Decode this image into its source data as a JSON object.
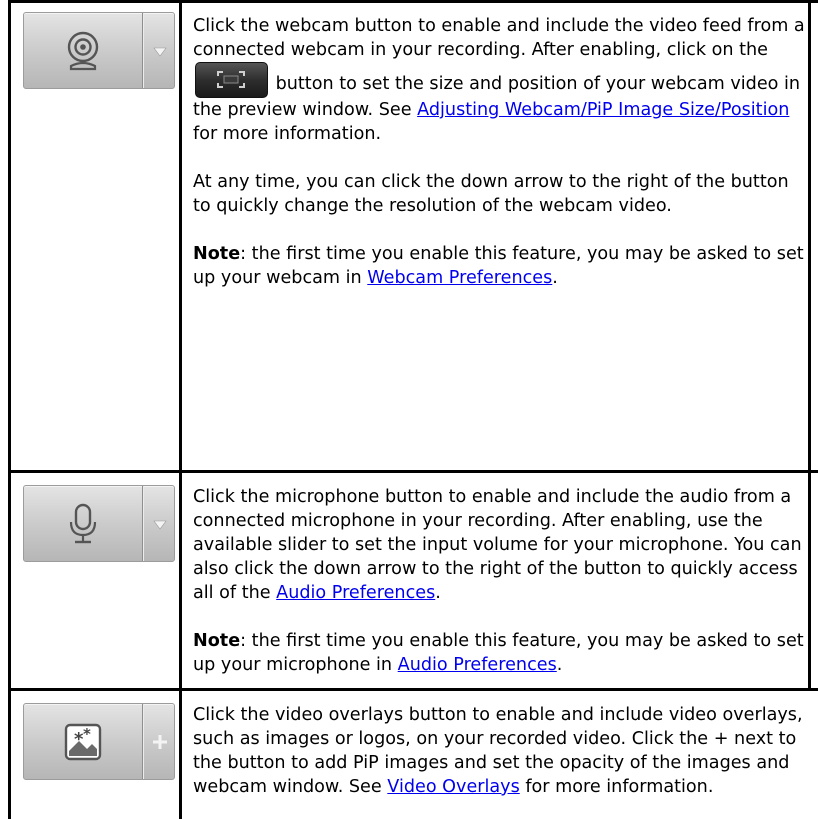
{
  "rows": [
    {
      "icon": "webcam-icon",
      "side_icon": "dropdown-arrow-icon",
      "p1_a": "Click the webcam button to enable and include the video feed from a connected webcam in your recording. After enabling, click on the",
      "p1_b": "button to set the size and position of your webcam video in the preview window. See",
      "p1_link": "Adjusting Webcam/PiP Image Size/Position",
      "p1_c": "for more information.",
      "p2": "At any time, you can click the down arrow to the right of the button to quickly change the resolution of the webcam video.",
      "note_label": "Note",
      "note_text": ": the first time you enable this feature, you may be asked to set up your webcam in",
      "note_link": "Webcam Preferences",
      "note_end": "."
    },
    {
      "icon": "microphone-icon",
      "side_icon": "dropdown-arrow-icon",
      "p1_a": "Click the microphone button to enable and include the audio from a connected microphone in your recording. After enabling, use the available slider to set the input volume for your microphone. You can also click the down arrow to the right of the button to quickly access all of the",
      "p1_link": "Audio Preferences",
      "p1_end": ".",
      "note_label": "Note",
      "note_text": ": the first time you enable this feature, you may be asked to set up your microphone in",
      "note_link": "Audio Preferences",
      "note_end": "."
    },
    {
      "icon": "video-overlay-icon",
      "side_icon": "plus-icon",
      "p1_a": "Click the video overlays button to enable and include video overlays, such as images or logos, on your recorded video. Click the + next to the button to add PiP images and set the opacity of the images and webcam window. See",
      "p1_link": "Video Overlays",
      "p1_c": "for more information."
    }
  ],
  "colors": {
    "link": "#0000ee",
    "border": "#000000",
    "button_top": "#e4e4e4",
    "button_bottom": "#b6b6b6"
  }
}
